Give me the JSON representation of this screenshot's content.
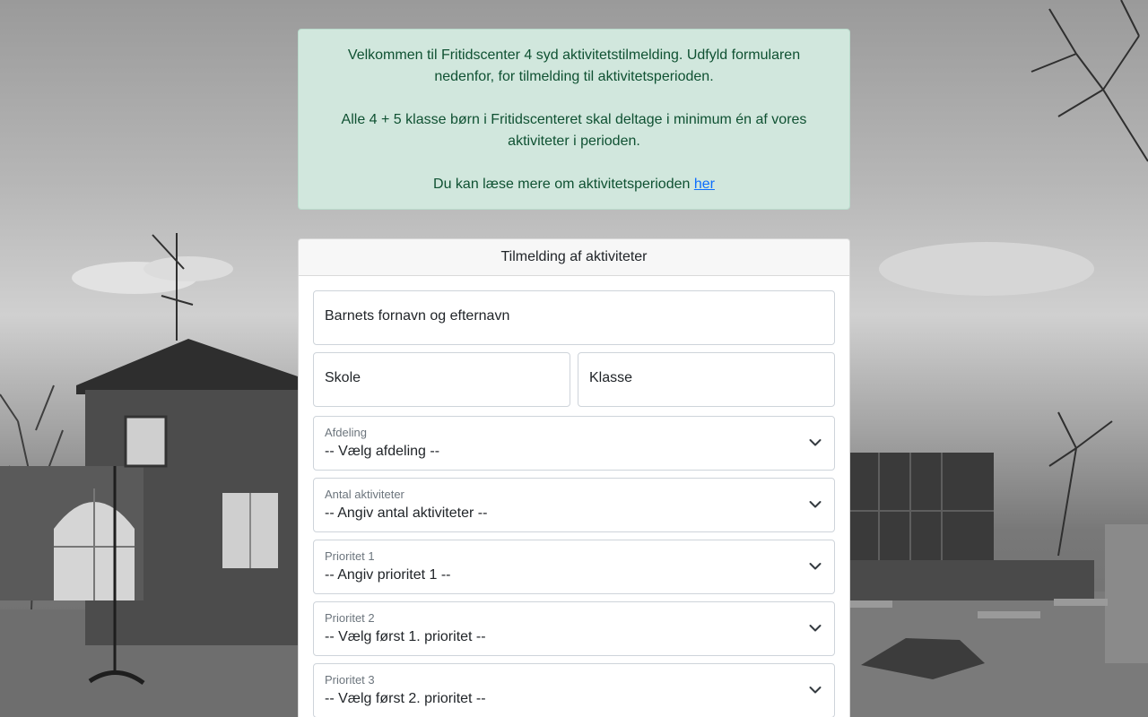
{
  "intro": {
    "paragraph1": "Velkommen til Fritidscenter 4 syd aktivitetstilmelding. Udfyld formularen nedenfor, for tilmelding til aktivitetsperioden.",
    "paragraph2": "Alle 4 + 5 klasse børn i Fritidscenteret skal deltage i minimum én af vores aktiviteter i perioden.",
    "paragraph3_text": "Du kan læse mere om aktivitetsperioden ",
    "paragraph3_link": "her"
  },
  "form": {
    "title": "Tilmelding af aktiviteter",
    "child_name_placeholder": "Barnets fornavn og efternavn",
    "school_placeholder": "Skole",
    "class_placeholder": "Klasse",
    "selects": [
      {
        "label": "Afdeling",
        "value": "-- Vælg afdeling --"
      },
      {
        "label": "Antal aktiviteter",
        "value": "-- Angiv antal aktiviteter --"
      },
      {
        "label": "Prioritet 1",
        "value": "-- Angiv prioritet 1 --"
      },
      {
        "label": "Prioritet 2",
        "value": "-- Vælg først 1. prioritet --"
      },
      {
        "label": "Prioritet 3",
        "value": "-- Vælg først 2. prioritet --"
      }
    ]
  },
  "colors": {
    "alert_bg": "#d1e7dd",
    "alert_text": "#0f5132",
    "link": "#0d6efd"
  },
  "icons": {
    "select_indicator": "chevron-down-icon"
  }
}
